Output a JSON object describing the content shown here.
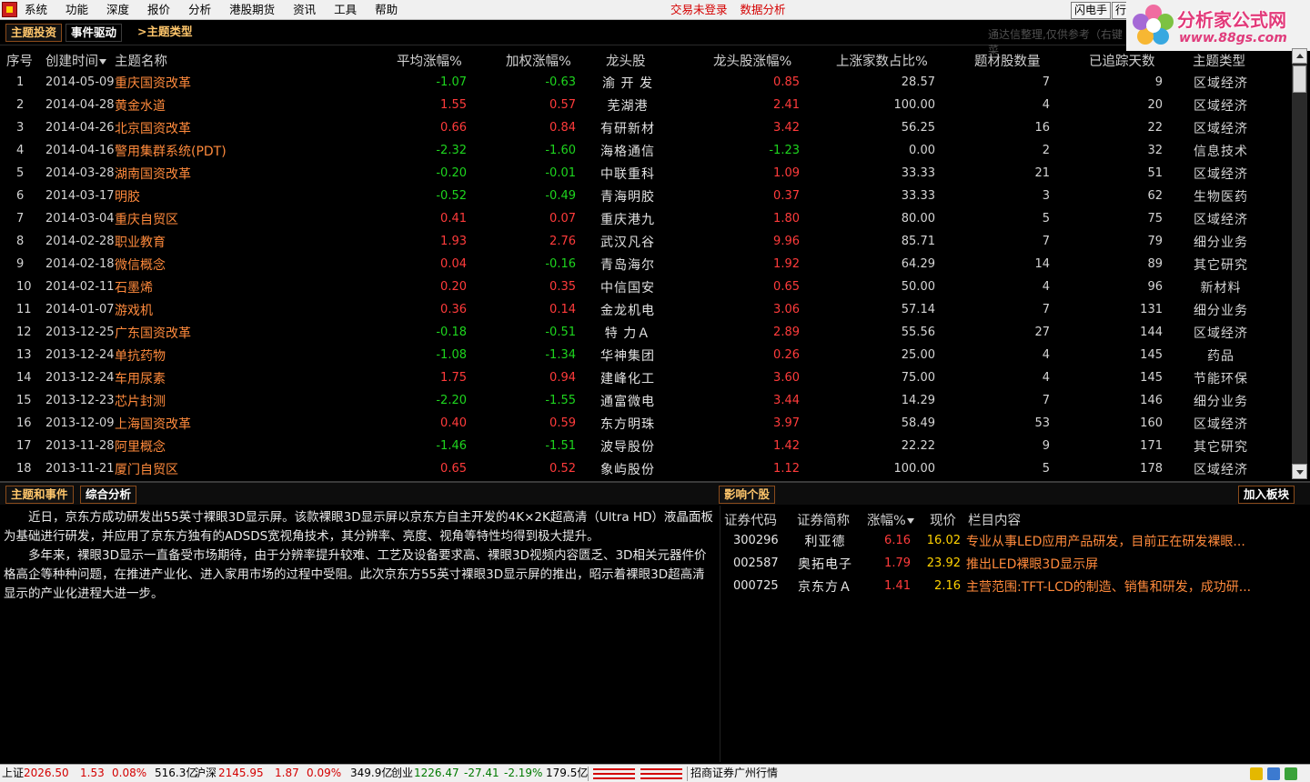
{
  "menu": {
    "items": [
      "系统",
      "功能",
      "深度",
      "报价",
      "分析",
      "港股期货",
      "资讯",
      "工具",
      "帮助"
    ],
    "alerts": [
      "交易未登录",
      "数据分析"
    ],
    "buttons": [
      "闪电手",
      "行"
    ]
  },
  "logo": {
    "title": "分析家公式网",
    "url": "www.88gs.com"
  },
  "toolbar": {
    "tabs": [
      "主题投资",
      "事件驱动",
      ">主题类型"
    ],
    "hint": "通达信整理,仅供参考（右键菜"
  },
  "table": {
    "headers": [
      "序号",
      "创建时间",
      "主题名称",
      "平均涨幅%",
      "加权涨幅%",
      "龙头股",
      "龙头股涨幅%",
      "上涨家数占比%",
      "题材股数量",
      "已追踪天数",
      "主题类型"
    ],
    "rows": [
      {
        "idx": "1",
        "date": "2014-05-09",
        "name": "重庆国资改革",
        "avg": "-1.07",
        "wavg": "-0.63",
        "leader": "渝 开 发",
        "lchg": "0.85",
        "ratio": "28.57",
        "count": "7",
        "days": "9",
        "type": "区域经济"
      },
      {
        "idx": "2",
        "date": "2014-04-28",
        "name": "黄金水道",
        "avg": "1.55",
        "wavg": "0.57",
        "leader": "芜湖港",
        "lchg": "2.41",
        "ratio": "100.00",
        "count": "4",
        "days": "20",
        "type": "区域经济"
      },
      {
        "idx": "3",
        "date": "2014-04-26",
        "name": "北京国资改革",
        "avg": "0.66",
        "wavg": "0.84",
        "leader": "有研新材",
        "lchg": "3.42",
        "ratio": "56.25",
        "count": "16",
        "days": "22",
        "type": "区域经济"
      },
      {
        "idx": "4",
        "date": "2014-04-16",
        "name": "警用集群系统(PDT)",
        "avg": "-2.32",
        "wavg": "-1.60",
        "leader": "海格通信",
        "lchg": "-1.23",
        "ratio": "0.00",
        "count": "2",
        "days": "32",
        "type": "信息技术"
      },
      {
        "idx": "5",
        "date": "2014-03-28",
        "name": "湖南国资改革",
        "avg": "-0.20",
        "wavg": "-0.01",
        "leader": "中联重科",
        "lchg": "1.09",
        "ratio": "33.33",
        "count": "21",
        "days": "51",
        "type": "区域经济"
      },
      {
        "idx": "6",
        "date": "2014-03-17",
        "name": "明胶",
        "avg": "-0.52",
        "wavg": "-0.49",
        "leader": "青海明胶",
        "lchg": "0.37",
        "ratio": "33.33",
        "count": "3",
        "days": "62",
        "type": "生物医药"
      },
      {
        "idx": "7",
        "date": "2014-03-04",
        "name": "重庆自贸区",
        "avg": "0.41",
        "wavg": "0.07",
        "leader": "重庆港九",
        "lchg": "1.80",
        "ratio": "80.00",
        "count": "5",
        "days": "75",
        "type": "区域经济"
      },
      {
        "idx": "8",
        "date": "2014-02-28",
        "name": "职业教育",
        "avg": "1.93",
        "wavg": "2.76",
        "leader": "武汉凡谷",
        "lchg": "9.96",
        "ratio": "85.71",
        "count": "7",
        "days": "79",
        "type": "细分业务"
      },
      {
        "idx": "9",
        "date": "2014-02-18",
        "name": "微信概念",
        "avg": "0.04",
        "wavg": "-0.16",
        "leader": "青岛海尔",
        "lchg": "1.92",
        "ratio": "64.29",
        "count": "14",
        "days": "89",
        "type": "其它研究"
      },
      {
        "idx": "10",
        "date": "2014-02-11",
        "name": "石墨烯",
        "avg": "0.20",
        "wavg": "0.35",
        "leader": "中信国安",
        "lchg": "0.65",
        "ratio": "50.00",
        "count": "4",
        "days": "96",
        "type": "新材料"
      },
      {
        "idx": "11",
        "date": "2014-01-07",
        "name": "游戏机",
        "avg": "0.36",
        "wavg": "0.14",
        "leader": "金龙机电",
        "lchg": "3.06",
        "ratio": "57.14",
        "count": "7",
        "days": "131",
        "type": "细分业务"
      },
      {
        "idx": "12",
        "date": "2013-12-25",
        "name": "广东国资改革",
        "avg": "-0.18",
        "wavg": "-0.51",
        "leader": "特 力Ａ",
        "lchg": "2.89",
        "ratio": "55.56",
        "count": "27",
        "days": "144",
        "type": "区域经济"
      },
      {
        "idx": "13",
        "date": "2013-12-24",
        "name": "单抗药物",
        "avg": "-1.08",
        "wavg": "-1.34",
        "leader": "华神集团",
        "lchg": "0.26",
        "ratio": "25.00",
        "count": "4",
        "days": "145",
        "type": "药品"
      },
      {
        "idx": "14",
        "date": "2013-12-24",
        "name": "车用尿素",
        "avg": "1.75",
        "wavg": "0.94",
        "leader": "建峰化工",
        "lchg": "3.60",
        "ratio": "75.00",
        "count": "4",
        "days": "145",
        "type": "节能环保"
      },
      {
        "idx": "15",
        "date": "2013-12-23",
        "name": "芯片封测",
        "avg": "-2.20",
        "wavg": "-1.55",
        "leader": "通富微电",
        "lchg": "3.44",
        "ratio": "14.29",
        "count": "7",
        "days": "146",
        "type": "细分业务"
      },
      {
        "idx": "16",
        "date": "2013-12-09",
        "name": "上海国资改革",
        "avg": "0.40",
        "wavg": "0.59",
        "leader": "东方明珠",
        "lchg": "3.97",
        "ratio": "58.49",
        "count": "53",
        "days": "160",
        "type": "区域经济"
      },
      {
        "idx": "17",
        "date": "2013-11-28",
        "name": "阿里概念",
        "avg": "-1.46",
        "wavg": "-1.51",
        "leader": "波导股份",
        "lchg": "1.42",
        "ratio": "22.22",
        "count": "9",
        "days": "171",
        "type": "其它研究"
      },
      {
        "idx": "18",
        "date": "2013-11-21",
        "name": "厦门自贸区",
        "avg": "0.65",
        "wavg": "0.52",
        "leader": "象屿股份",
        "lchg": "1.12",
        "ratio": "100.00",
        "count": "5",
        "days": "178",
        "type": "区域经济"
      }
    ]
  },
  "lower": {
    "tabs": [
      "主题和事件",
      "综合分析"
    ],
    "impact_tab": "影响个股",
    "add_button": "加入板块",
    "article": [
      "近日，京东方成功研发出55英寸裸眼3D显示屏。该款裸眼3D显示屏以京东方自主开发的4K×2K超高清（Ultra HD）液晶面板为基础进行研发，并应用了京东方独有的ADSDS宽视角技术，其分辨率、亮度、视角等特性均得到极大提升。",
      "多年来，裸眼3D显示一直备受市场期待，由于分辨率提升较难、工艺及设备要求高、裸眼3D视频内容匮乏、3D相关元器件价格高企等种种问题，在推进产业化、进入家用市场的过程中受阻。此次京东方55英寸裸眼3D显示屏的推出，昭示着裸眼3D超高清显示的产业化进程大进一步。"
    ],
    "stock_headers": [
      "证券代码",
      "证券简称",
      "涨幅%",
      "现价",
      "栏目内容"
    ],
    "stocks": [
      {
        "code": "300296",
        "name": "利亚德",
        "chg": "6.16",
        "price": "16.02",
        "desc": "专业从事LED应用产品研发，目前正在研发裸眼..."
      },
      {
        "code": "002587",
        "name": "奥拓电子",
        "chg": "1.79",
        "price": "23.92",
        "desc": "推出LED裸眼3D显示屏"
      },
      {
        "code": "000725",
        "name": "京东方Ａ",
        "chg": "1.41",
        "price": "2.16",
        "desc": "主营范围:TFT-LCD的制造、销售和研发，成功研..."
      }
    ]
  },
  "status": {
    "sh_label": "上证",
    "sh_val": "2026.50",
    "sh_chg": "1.53",
    "sh_pct": "0.08%",
    "sh_amt": "516.3亿",
    "hs_label": "沪深",
    "hs_val": "2145.95",
    "hs_chg": "1.87",
    "hs_pct": "0.09%",
    "hs_amt": "349.9亿",
    "cy_label": "创业",
    "cy_val": "1226.47",
    "cy_chg": "-27.41",
    "cy_pct": "-2.19%",
    "cy_amt": "179.5亿",
    "broker": "招商证券广州行情"
  },
  "colors": {
    "up": "#ff3b3b",
    "down": "#1ed51e",
    "theme_name": "#ff8a3c",
    "price": "#ffd200",
    "tab_active": "#ffc66b"
  }
}
